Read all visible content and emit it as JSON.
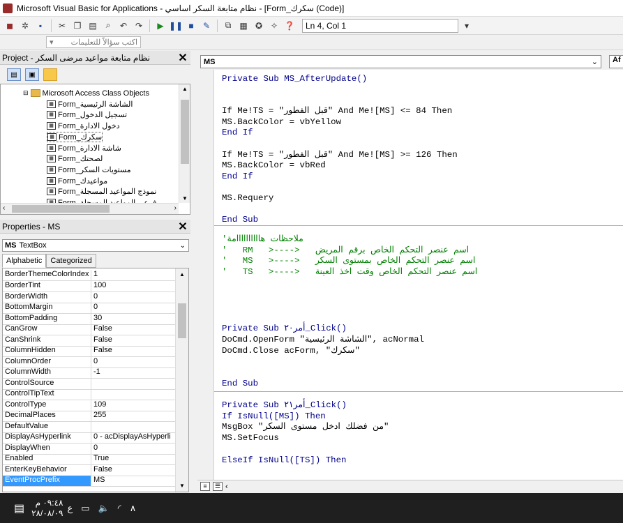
{
  "window": {
    "title": "Microsoft Visual Basic for Applications - نظام متابعة السكر اساسي - [Form_سكرك (Code)]"
  },
  "toolbar": {
    "position": "Ln 4, Col 1"
  },
  "help": {
    "placeholder": "اكتب سؤالاً للتعليمات"
  },
  "project": {
    "title": "Project - نظام متابعة مواعيد مرضى السكر",
    "folder": "Microsoft Access Class Objects",
    "items": [
      "Form_الشاشة الرئيسية",
      "Form_تسجيل الدخول",
      "Form_دخول الادارة",
      "Form_سكرك",
      "Form_شاشة الادارة",
      "Form_لصحتك",
      "Form_مستويات السكر",
      "Form_مواعيدك",
      "Form_نموذج المواعيد المسجلة",
      "Form_فرعي المواعيد المسجلة"
    ]
  },
  "properties": {
    "title": "Properties - MS",
    "object_name": "MS",
    "object_type": "TextBox",
    "tabs": [
      "Alphabetic",
      "Categorized"
    ],
    "rows": [
      {
        "name": "BorderThemeColorIndex",
        "value": "1"
      },
      {
        "name": "BorderTint",
        "value": "100"
      },
      {
        "name": "BorderWidth",
        "value": "0"
      },
      {
        "name": "BottomMargin",
        "value": "0"
      },
      {
        "name": "BottomPadding",
        "value": "30"
      },
      {
        "name": "CanGrow",
        "value": "False"
      },
      {
        "name": "CanShrink",
        "value": "False"
      },
      {
        "name": "ColumnHidden",
        "value": "False"
      },
      {
        "name": "ColumnOrder",
        "value": "0"
      },
      {
        "name": "ColumnWidth",
        "value": "-1"
      },
      {
        "name": "ControlSource",
        "value": ""
      },
      {
        "name": "ControlTipText",
        "value": ""
      },
      {
        "name": "ControlType",
        "value": "109"
      },
      {
        "name": "DecimalPlaces",
        "value": "255"
      },
      {
        "name": "DefaultValue",
        "value": ""
      },
      {
        "name": "DisplayAsHyperlink",
        "value": "0 - acDisplayAsHyperli"
      },
      {
        "name": "DisplayWhen",
        "value": "0"
      },
      {
        "name": "Enabled",
        "value": "True"
      },
      {
        "name": "EnterKeyBehavior",
        "value": "False"
      },
      {
        "name": "EventProcPrefix",
        "value": "MS"
      }
    ]
  },
  "code": {
    "object_combo": "MS",
    "proc_combo": "Af",
    "lines": [
      "Private Sub MS_AfterUpdate()",
      "If Me!TS = \"قبل الفطور\" And Me![MS] <= 84 Then",
      "MS.BackColor = vbYellow",
      "End If",
      "If Me!TS = \"قبل الفطور\" And Me![MS] >= 126 Then",
      "MS.BackColor = vbRed",
      "End If",
      "MS.Requery",
      "End Sub",
      "'ملاحظات هاااااااااامة",
      "'   RM   >---->   اسم عنصر التحكم الخاص برقم المريض",
      "'   MS   >---->   اسم عنصر التحكم الخاص بمستوى السكر",
      "'   TS   >---->   اسم عنصر التحكم الخاص وقت اخذ العينة",
      "Private Sub أمر٢٠_Click()",
      "DoCmd.OpenForm \"الشاشة الرئيسية\", acNormal",
      "DoCmd.Close acForm, \"سكرك\"",
      "End Sub",
      "Private Sub أمر٢١_Click()",
      "If IsNull([MS]) Then",
      "MsgBox \"من فضلك ادخل مستوى السكر\"",
      "MS.SetFocus",
      "ElseIf IsNull([TS]) Then"
    ]
  },
  "taskbar": {
    "time": "٠٩:٤٨ م",
    "date": "٢٨/٠٨/٠٩",
    "lang": "ع"
  },
  "icons": [
    "access-icon",
    "save-icon",
    "run-icon",
    "pause-icon",
    "stop-icon",
    "help-icon",
    "form-icon",
    "folder-icon",
    "notification-icon",
    "battery-icon",
    "volume-icon",
    "wifi-icon",
    "chevron-up-icon"
  ]
}
